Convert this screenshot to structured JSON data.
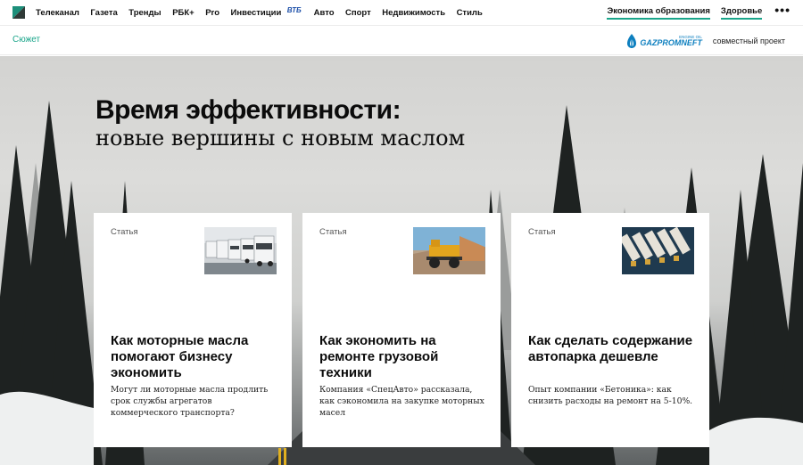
{
  "nav": {
    "items": [
      "Телеканал",
      "Газета",
      "Тренды",
      "РБК+",
      "Pro",
      "Инвестиции",
      "Авто",
      "Спорт",
      "Недвижимость",
      "Стиль"
    ],
    "vtb_label": "ВТБ",
    "right_items": [
      "Экономика образования",
      "Здоровье"
    ],
    "more_label": "•••"
  },
  "subbar": {
    "story_label": "Сюжет",
    "partner_small": "ENGINE OIL",
    "partner_name": "GAZPROMNEFT",
    "joint_label": "совместный проект"
  },
  "hero": {
    "title_line1": "Время эффективности:",
    "title_line2": "новые вершины с новым маслом"
  },
  "cards": [
    {
      "type": "Статья",
      "title": "Как моторные масла помогают бизнесу экономить",
      "desc": "Могут ли моторные масла продлить срок службы агрегатов коммерческого транспорта?"
    },
    {
      "type": "Статья",
      "title": "Как экономить на ремонте грузовой техники",
      "desc": "Компания «СпецАвто» рассказала, как сэкономила на закупке моторных масел"
    },
    {
      "type": "Статья",
      "title": "Как сделать содержание автопарка дешевле",
      "desc": "Опыт компании «Бетоника»: как снизить расходы на ремонт на 5-10%."
    }
  ],
  "colors": {
    "accent": "#1aa58a",
    "partner_blue": "#0d7fbf"
  }
}
